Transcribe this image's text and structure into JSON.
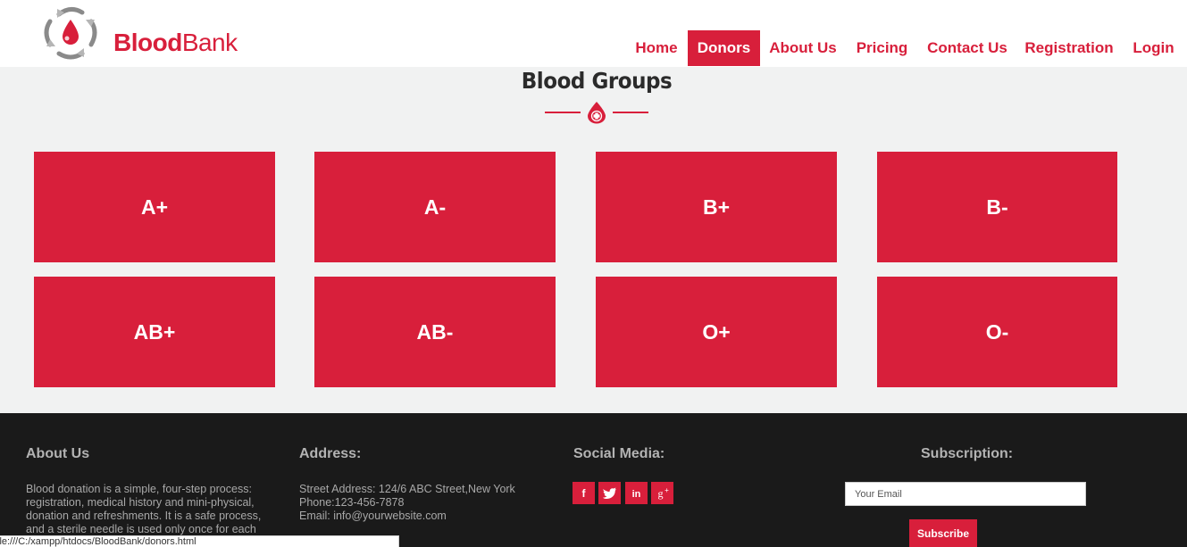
{
  "brand": {
    "bold": "Blood",
    "regular": "Bank"
  },
  "nav": [
    {
      "label": "Home",
      "active": false
    },
    {
      "label": "Donors",
      "active": true
    },
    {
      "label": "About Us",
      "active": false
    },
    {
      "label": "Pricing",
      "active": false
    },
    {
      "label": "Contact Us",
      "active": false
    },
    {
      "label": "Registration",
      "active": false
    },
    {
      "label": "Login",
      "active": false
    }
  ],
  "section": {
    "title": "Blood Groups"
  },
  "blood_groups": [
    "A+",
    "A-",
    "B+",
    "B-",
    "AB+",
    "AB-",
    "O+",
    "O-"
  ],
  "footer": {
    "about": {
      "heading": "About Us",
      "lines": [
        "Blood donation is a simple, four-step process:",
        "registration, medical history and mini-physical,",
        "donation and refreshments. It is a safe process,",
        "and a sterile needle is used only once for each"
      ]
    },
    "address": {
      "heading": "Address:",
      "lines": [
        "Street Address: 124/6 ABC Street,New York",
        "Phone:123-456-7878",
        "Email: info@yourwebsite.com"
      ]
    },
    "social": {
      "heading": "Social Media:",
      "icons": [
        "facebook-icon",
        "twitter-icon",
        "linkedin-icon",
        "google-plus-icon"
      ]
    },
    "subscription": {
      "heading": "Subscription:",
      "email_placeholder": "Your Email",
      "email_value": "",
      "button_label": "Subscribe"
    }
  },
  "statusbar": {
    "url": "ile:///C:/xampp/htdocs/BloodBank/donors.html"
  },
  "colors": {
    "accent": "#d81f3b",
    "background": "#f1f2f2",
    "footer": "#1a1a1a",
    "footer_text": "#a8a8a8"
  }
}
